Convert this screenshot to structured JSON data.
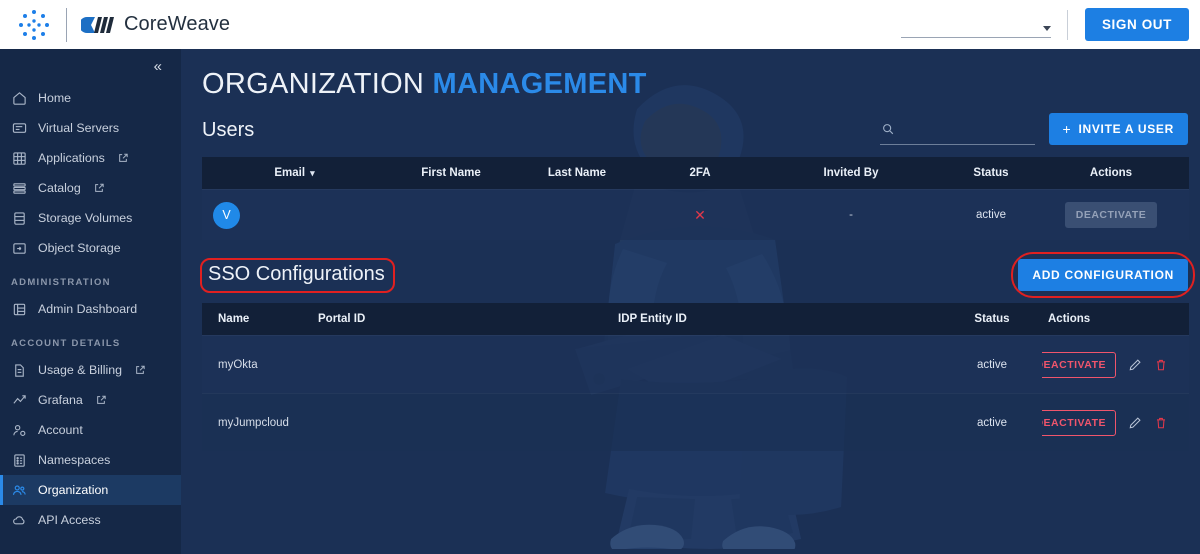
{
  "topbar": {
    "brand_name": "CoreWeave",
    "org_select_value": "",
    "sign_out_label": "SIGN OUT"
  },
  "sidebar": {
    "collapse_label": "«",
    "items": [
      {
        "label": "Home",
        "icon": "home-icon",
        "external": false,
        "active": false
      },
      {
        "label": "Virtual Servers",
        "icon": "monitor-icon",
        "external": false,
        "active": false
      },
      {
        "label": "Applications",
        "icon": "grid-icon",
        "external": true,
        "active": false
      },
      {
        "label": "Catalog",
        "icon": "list-icon",
        "external": true,
        "active": false
      },
      {
        "label": "Storage Volumes",
        "icon": "database-icon",
        "external": false,
        "active": false
      },
      {
        "label": "Object Storage",
        "icon": "folder-share-icon",
        "external": false,
        "active": false
      }
    ],
    "group_administration": "ADMINISTRATION",
    "admin_items": [
      {
        "label": "Admin Dashboard",
        "icon": "dashboard-icon",
        "external": false,
        "active": false
      }
    ],
    "group_account_details": "ACCOUNT DETAILS",
    "account_items": [
      {
        "label": "Usage & Billing",
        "icon": "document-icon",
        "external": true,
        "active": false
      },
      {
        "label": "Grafana",
        "icon": "chart-line-icon",
        "external": true,
        "active": false
      },
      {
        "label": "Account",
        "icon": "user-gear-icon",
        "external": false,
        "active": false
      },
      {
        "label": "Namespaces",
        "icon": "namespace-icon",
        "external": false,
        "active": false
      },
      {
        "label": "Organization",
        "icon": "users-icon",
        "external": false,
        "active": true
      },
      {
        "label": "API Access",
        "icon": "cloud-icon",
        "external": false,
        "active": false
      }
    ]
  },
  "main": {
    "title_part1": "ORGANIZATION",
    "title_part2": "MANAGEMENT",
    "users_section": {
      "heading": "Users",
      "search_placeholder": "",
      "search_value": "",
      "invite_button": "INVITE A USER",
      "columns": [
        "Email",
        "First Name",
        "Last Name",
        "2FA",
        "Invited By",
        "Status",
        "Actions"
      ],
      "rows": [
        {
          "avatar_initial": "V",
          "email": "",
          "first_name": "",
          "last_name": "",
          "twofa": "✕",
          "invited_by": "-",
          "status": "active",
          "action_label": "DEACTIVATE"
        }
      ]
    },
    "sso_section": {
      "heading": "SSO Configurations",
      "add_button": "ADD CONFIGURATION",
      "columns": [
        "Name",
        "Portal ID",
        "IDP Entity ID",
        "Status",
        "Actions"
      ],
      "rows": [
        {
          "name": "myOkta",
          "portal_id": "",
          "idp_entity_id": "",
          "status": "active",
          "action_label": "DEACTIVATE",
          "edit_icon": "pencil-icon",
          "delete_icon": "trash-icon"
        },
        {
          "name": "myJumpcloud",
          "portal_id": "",
          "idp_entity_id": "",
          "status": "active",
          "action_label": "DEACTIVATE",
          "edit_icon": "pencil-icon",
          "delete_icon": "trash-icon"
        }
      ]
    }
  },
  "colors": {
    "accent_blue": "#1d7fe8",
    "danger_red": "#f0556c",
    "annotation_red": "#e02020",
    "sidebar_bg": "#152847",
    "main_bg": "#1b3055",
    "table_header_bg": "#122038"
  }
}
